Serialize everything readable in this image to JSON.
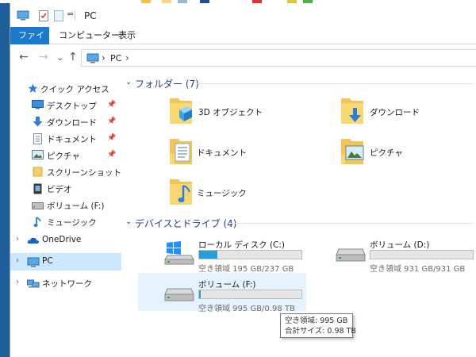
{
  "window": {
    "title": "PC",
    "qat_dropdown": "="
  },
  "ribbon": {
    "tabs": [
      "ファイル",
      "コンピューター",
      "表示"
    ]
  },
  "address": {
    "back": "←",
    "forward": "→",
    "recent": "⌄",
    "up": "↑",
    "sep": "›",
    "path": "PC",
    "trail": "›"
  },
  "nav": {
    "quick_access": "クイック アクセス",
    "items": [
      {
        "label": "デスクトップ",
        "icon": "desktop-icon",
        "pinned": true
      },
      {
        "label": "ダウンロード",
        "icon": "download-icon",
        "pinned": true
      },
      {
        "label": "ドキュメント",
        "icon": "document-icon",
        "pinned": true
      },
      {
        "label": "ピクチャ",
        "icon": "pictures-icon",
        "pinned": true
      },
      {
        "label": "スクリーンショット",
        "icon": "folder-icon",
        "pinned": false
      },
      {
        "label": "ビデオ",
        "icon": "video-icon",
        "pinned": false
      },
      {
        "label": "ボリューム (F:)",
        "icon": "drive-icon",
        "pinned": false
      },
      {
        "label": "ミュージック",
        "icon": "music-icon",
        "pinned": false
      }
    ],
    "onedrive": "OneDrive",
    "pc": "PC",
    "network": "ネットワーク"
  },
  "content": {
    "folders_header": "フォルダー (7)",
    "folders": [
      {
        "label": "3D オブジェクト",
        "icon": "3d-objects-folder-icon"
      },
      {
        "label": "ダウンロード",
        "icon": "downloads-folder-icon"
      },
      {
        "label": "ドキュメント",
        "icon": "documents-folder-icon"
      },
      {
        "label": "ピクチャ",
        "icon": "pictures-folder-icon"
      },
      {
        "label": "ミュージック",
        "icon": "music-folder-icon"
      }
    ],
    "drives_header": "デバイスとドライブ (4)",
    "drives": [
      {
        "name": "ローカル ディスク (C:)",
        "free": "空き領域 195 GB/237 GB",
        "used_fraction": 0.18,
        "icon": "windows-drive-icon"
      },
      {
        "name": "ボリューム (D:)",
        "free": "空き領域 931 GB/931 GB",
        "used_fraction": 0.0,
        "icon": "drive-icon"
      },
      {
        "name": "ボリューム (F:)",
        "free": "空き領域 995 GB/0.98 TB",
        "used_fraction": 0.01,
        "icon": "drive-icon"
      }
    ]
  },
  "tooltip": {
    "line1": "空き領域: 995 GB",
    "line2": "合計サイズ: 0.98 TB"
  },
  "colors": {
    "accent": "#1979ca",
    "header_text": "#1e3f8a",
    "selection": "#cce8ff",
    "hover": "#e5f3ff",
    "bar_fill": "#26a0da"
  }
}
